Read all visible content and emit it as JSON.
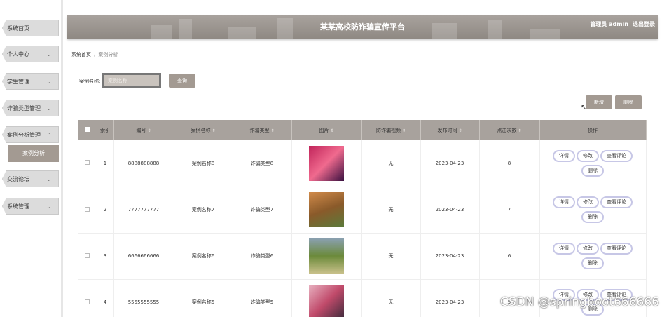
{
  "sidebar": {
    "items": [
      {
        "label": "系统首页",
        "chevron": false
      },
      {
        "label": "个人中心",
        "chevron": true
      },
      {
        "label": "学生管理",
        "chevron": true
      },
      {
        "label": "诈骗类型管理",
        "chevron": true
      },
      {
        "label": "案例分析管理",
        "chevron": true,
        "expanded": true
      },
      {
        "label": "交流论坛",
        "chevron": true
      },
      {
        "label": "系统管理",
        "chevron": true
      }
    ],
    "sub_item": "案例分析"
  },
  "header": {
    "title": "某某高校防诈骗宣传平台",
    "user": "管理员 admin",
    "logout": "退出登录"
  },
  "breadcrumb": {
    "home": "系统首页",
    "current": "案例分析"
  },
  "search": {
    "label": "案例名称:",
    "placeholder": "案例名称",
    "button": "查询"
  },
  "actions": {
    "add": "新增",
    "delete": "删除"
  },
  "table": {
    "headers": [
      "索引",
      "编号",
      "案例名称",
      "诈骗类型",
      "图片",
      "防诈骗视频",
      "发布时间",
      "点击次数",
      "操作"
    ],
    "rows": [
      {
        "index": "1",
        "code": "8888888888",
        "name": "案例名称8",
        "type": "诈骗类型8",
        "video": "无",
        "date": "2023-04-23",
        "clicks": "8",
        "thumb_colors": [
          "#c0245a",
          "#f06a8e"
        ]
      },
      {
        "index": "2",
        "code": "7777777777",
        "name": "案例名称7",
        "type": "诈骗类型7",
        "video": "无",
        "date": "2023-04-23",
        "clicks": "7",
        "thumb_colors": [
          "#8a5a2a",
          "#d08a4a"
        ]
      },
      {
        "index": "3",
        "code": "6666666666",
        "name": "案例名称6",
        "type": "诈骗类型6",
        "video": "无",
        "date": "2023-04-23",
        "clicks": "6",
        "thumb_colors": [
          "#6b8a3a",
          "#c8c08a"
        ]
      },
      {
        "index": "4",
        "code": "5555555555",
        "name": "案例名称5",
        "type": "诈骗类型5",
        "video": "无",
        "date": "2023-04-23",
        "clicks": "5",
        "thumb_colors": [
          "#c04a6a",
          "#e8b0c0"
        ]
      }
    ],
    "op_labels": {
      "detail": "详情",
      "edit": "修改",
      "comments": "查看评论",
      "delete": "删除"
    }
  },
  "watermark": "CSDN @springboot666666",
  "colors": {
    "accent": "#a39a92",
    "header": "#a8a29d",
    "op_border": "#c7c7e6"
  }
}
